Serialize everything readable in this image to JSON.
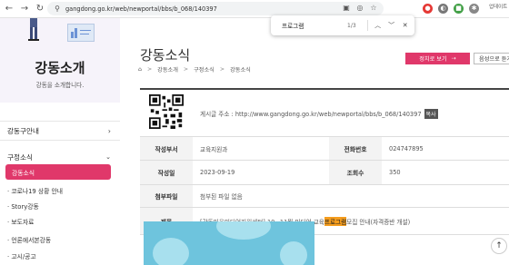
{
  "browser": {
    "url": "gangdong.go.kr/web/newportal/bbs/b_068/140397",
    "profile_label": "업데이트"
  },
  "find_bar": {
    "query": "프로그램",
    "count": "1/3"
  },
  "sidebar": {
    "title": "강동소개",
    "subtitle": "강동을 소개합니다.",
    "menu_top": "강동구안내",
    "group_label": "구정소식",
    "active_item": "강동소식",
    "sub_items": [
      "· 코로나19 상황 안내",
      "· Story강동",
      "· 보도자료",
      "· 언론에서본강동",
      "· 고시/공고"
    ]
  },
  "main": {
    "page_title": "강동소식",
    "breadcrumb": [
      "강동소개",
      "구정소식",
      "강동소식"
    ],
    "share_button": "정치로 보기",
    "audio_button": "음성으로 듣기"
  },
  "post": {
    "address_label": "게시글 주소 : http://www.gangdong.go.kr/web/newportal/bbs/b_068/140397",
    "copy_label": "복사",
    "dept_label": "작성부서",
    "dept_value": "교육지원과",
    "phone_label": "전화번호",
    "phone_value": "024747895",
    "date_label": "작성일",
    "date_value": "2023-09-19",
    "views_label": "조회수",
    "views_value": "350",
    "attach_label": "첨부파일",
    "attach_value": "첨부된 파일 없음",
    "subject_label": "제목",
    "subject_before": "[강동마을미디어지원센터] 10~11월 미디어 교육 ",
    "subject_highlight": "프로그램",
    "subject_after": " 모집 안내(자격증반 개설)"
  },
  "colors": {
    "accent": "#e0386a",
    "highlight": "#f59d1e"
  }
}
